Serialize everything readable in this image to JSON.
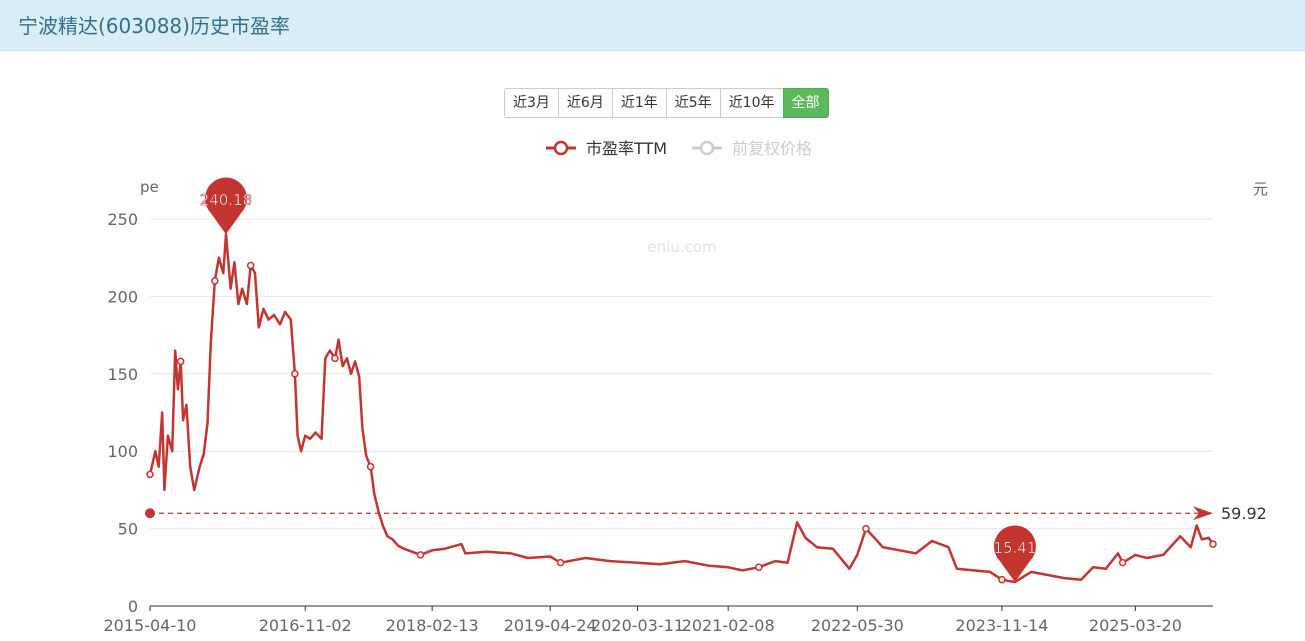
{
  "page": {
    "title": "宁波精达(603088)历史市盈率"
  },
  "range_buttons": [
    {
      "label": "近3月",
      "active": false
    },
    {
      "label": "近6月",
      "active": false
    },
    {
      "label": "近1年",
      "active": false
    },
    {
      "label": "近5年",
      "active": false
    },
    {
      "label": "近10年",
      "active": false
    },
    {
      "label": "全部",
      "active": true
    }
  ],
  "colors": {
    "pe_line": "#c23531",
    "price_line_inactive": "#cccccc",
    "active_button": "#5cb85c",
    "header_bg": "#d9edf7"
  },
  "chart_data": {
    "type": "line",
    "watermark": "eniu.com",
    "legend": [
      "市盈率TTM",
      "前复权价格"
    ],
    "legend_active": [
      true,
      false
    ],
    "legend_position": "top-center",
    "y_axis_label": "pe",
    "y2_axis_label": "元",
    "ylim": [
      0,
      250
    ],
    "y_ticks": [
      0,
      50,
      100,
      150,
      200,
      250
    ],
    "x_tick_labels": [
      "2015-04-10",
      "2016-11-02",
      "2018-02-13",
      "2019-04-24",
      "2020-03-11",
      "2021-02-08",
      "2022-05-30",
      "2023-11-14",
      "2025-03-20"
    ],
    "x_range": [
      "2015-04-10",
      "2025-12-31"
    ],
    "grid": true,
    "series": [
      {
        "name": "市盈率TTM",
        "points": [
          [
            "2015-04-10",
            85
          ],
          [
            "2015-04-30",
            100
          ],
          [
            "2015-05-12",
            90
          ],
          [
            "2015-05-25",
            125
          ],
          [
            "2015-06-02",
            75
          ],
          [
            "2015-06-15",
            110
          ],
          [
            "2015-07-01",
            100
          ],
          [
            "2015-07-12",
            165
          ],
          [
            "2015-07-22",
            140
          ],
          [
            "2015-08-01",
            158
          ],
          [
            "2015-08-10",
            120
          ],
          [
            "2015-08-22",
            130
          ],
          [
            "2015-09-05",
            90
          ],
          [
            "2015-09-20",
            75
          ],
          [
            "2015-10-10",
            90
          ],
          [
            "2015-10-25",
            98
          ],
          [
            "2015-11-08",
            118
          ],
          [
            "2015-11-20",
            170
          ],
          [
            "2015-12-05",
            210
          ],
          [
            "2015-12-20",
            225
          ],
          [
            "2016-01-05",
            215
          ],
          [
            "2016-01-15",
            240.18
          ],
          [
            "2016-02-01",
            205
          ],
          [
            "2016-02-15",
            222
          ],
          [
            "2016-03-01",
            195
          ],
          [
            "2016-03-15",
            205
          ],
          [
            "2016-04-01",
            195
          ],
          [
            "2016-04-15",
            220
          ],
          [
            "2016-05-01",
            215
          ],
          [
            "2016-05-15",
            180
          ],
          [
            "2016-06-01",
            192
          ],
          [
            "2016-06-20",
            185
          ],
          [
            "2016-07-10",
            188
          ],
          [
            "2016-08-01",
            182
          ],
          [
            "2016-08-20",
            190
          ],
          [
            "2016-09-10",
            185
          ],
          [
            "2016-09-25",
            150
          ],
          [
            "2016-10-05",
            110
          ],
          [
            "2016-10-18",
            100
          ],
          [
            "2016-11-02",
            110
          ],
          [
            "2016-11-20",
            108
          ],
          [
            "2016-12-10",
            112
          ],
          [
            "2017-01-01",
            108
          ],
          [
            "2017-01-15",
            160
          ],
          [
            "2017-02-01",
            165
          ],
          [
            "2017-02-20",
            160
          ],
          [
            "2017-03-05",
            172
          ],
          [
            "2017-03-20",
            155
          ],
          [
            "2017-04-05",
            160
          ],
          [
            "2017-04-20",
            150
          ],
          [
            "2017-05-05",
            158
          ],
          [
            "2017-05-20",
            148
          ],
          [
            "2017-06-01",
            115
          ],
          [
            "2017-06-15",
            97
          ],
          [
            "2017-07-01",
            90
          ],
          [
            "2017-07-15",
            72
          ],
          [
            "2017-08-01",
            60
          ],
          [
            "2017-08-15",
            52
          ],
          [
            "2017-09-01",
            45
          ],
          [
            "2017-09-20",
            43
          ],
          [
            "2017-10-10",
            39
          ],
          [
            "2017-11-01",
            37
          ],
          [
            "2017-12-01",
            35
          ],
          [
            "2018-01-01",
            33
          ],
          [
            "2018-02-13",
            36
          ],
          [
            "2018-04-01",
            37
          ],
          [
            "2018-06-01",
            40
          ],
          [
            "2018-06-15",
            34
          ],
          [
            "2018-09-01",
            35
          ],
          [
            "2018-12-01",
            34
          ],
          [
            "2019-02-01",
            31
          ],
          [
            "2019-04-24",
            32
          ],
          [
            "2019-06-01",
            28
          ],
          [
            "2019-09-01",
            31
          ],
          [
            "2019-12-01",
            29
          ],
          [
            "2020-03-11",
            28
          ],
          [
            "2020-06-01",
            27
          ],
          [
            "2020-09-01",
            29
          ],
          [
            "2020-12-01",
            26
          ],
          [
            "2021-02-08",
            25
          ],
          [
            "2021-04-01",
            23
          ],
          [
            "2021-06-01",
            25
          ],
          [
            "2021-08-01",
            29
          ],
          [
            "2021-09-15",
            28
          ],
          [
            "2021-10-20",
            54
          ],
          [
            "2021-11-20",
            44
          ],
          [
            "2022-01-01",
            38
          ],
          [
            "2022-03-01",
            37
          ],
          [
            "2022-05-01",
            24
          ],
          [
            "2022-05-30",
            33
          ],
          [
            "2022-07-01",
            50
          ],
          [
            "2022-09-01",
            38
          ],
          [
            "2022-11-01",
            36
          ],
          [
            "2023-01-01",
            34
          ],
          [
            "2023-03-01",
            42
          ],
          [
            "2023-05-01",
            38
          ],
          [
            "2023-06-01",
            24
          ],
          [
            "2023-08-01",
            23
          ],
          [
            "2023-10-01",
            22
          ],
          [
            "2023-11-14",
            17
          ],
          [
            "2024-01-01",
            15.41
          ],
          [
            "2024-03-01",
            22
          ],
          [
            "2024-05-01",
            20
          ],
          [
            "2024-07-01",
            18
          ],
          [
            "2024-09-01",
            17
          ],
          [
            "2024-10-15",
            25
          ],
          [
            "2024-12-01",
            24
          ],
          [
            "2025-01-15",
            34
          ],
          [
            "2025-02-01",
            28
          ],
          [
            "2025-03-20",
            33
          ],
          [
            "2025-05-01",
            31
          ],
          [
            "2025-07-01",
            33
          ],
          [
            "2025-09-01",
            45
          ],
          [
            "2025-10-10",
            38
          ],
          [
            "2025-11-01",
            52
          ],
          [
            "2025-11-20",
            43
          ],
          [
            "2025-12-15",
            44
          ],
          [
            "2025-12-31",
            40
          ]
        ]
      }
    ],
    "annotations": {
      "max": {
        "date": "2016-01-15",
        "value": 240.18,
        "label": "240.18"
      },
      "min": {
        "date": "2024-01-01",
        "value": 15.41,
        "label": "15.41"
      },
      "mean": {
        "value": 59.92,
        "label": "59.92"
      }
    }
  }
}
